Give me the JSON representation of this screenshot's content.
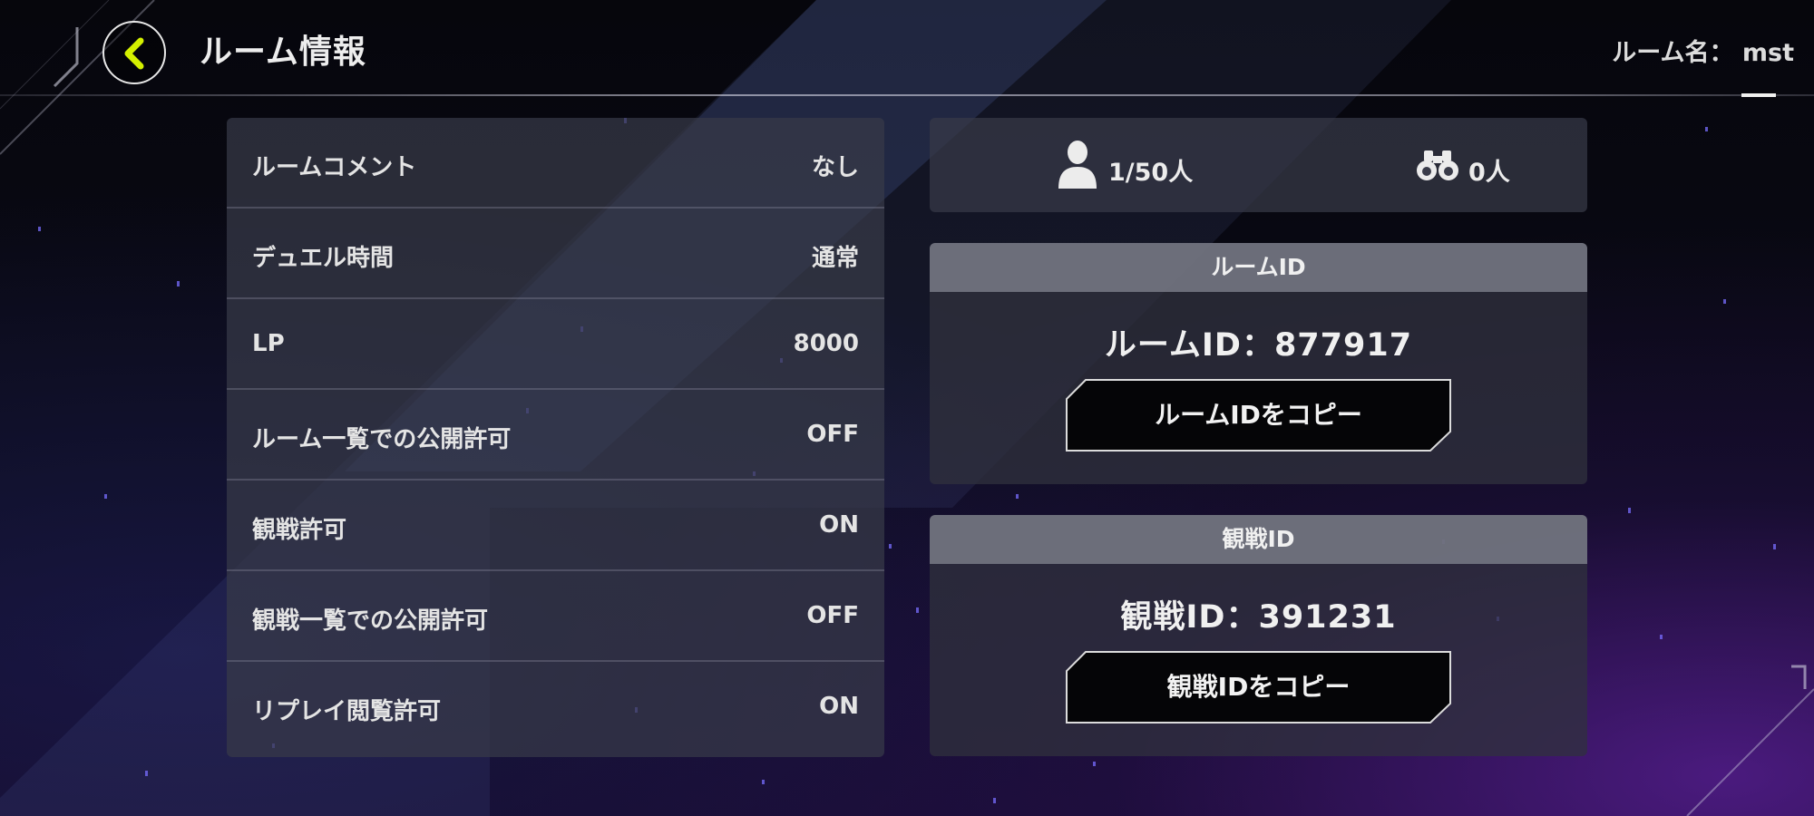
{
  "header": {
    "title": "ルーム情報",
    "room_name": "ルーム名： mst",
    "back_icon": "chevron-left-icon",
    "accent_color": "#d4f000"
  },
  "settings": [
    {
      "label": "ルームコメント",
      "value": "なし"
    },
    {
      "label": "デュエル時間",
      "value": "通常"
    },
    {
      "label": "LP",
      "value": "8000"
    },
    {
      "label": "ルーム一覧での公開許可",
      "value": "OFF"
    },
    {
      "label": "観戦許可",
      "value": "ON"
    },
    {
      "label": "観戦一覧での公開許可",
      "value": "OFF"
    },
    {
      "label": "リプレイ閲覧許可",
      "value": "ON"
    }
  ],
  "counts": {
    "players": "1/50人",
    "players_icon": "person-icon",
    "spectators": "0人",
    "spectators_icon": "binoculars-icon"
  },
  "room_id": {
    "header": "ルームID",
    "value": "ルームID：877917",
    "copy_label": "ルームIDをコピー"
  },
  "spectate_id": {
    "header": "観戦ID",
    "value": "観戦ID：391231",
    "copy_label": "観戦IDをコピー"
  }
}
